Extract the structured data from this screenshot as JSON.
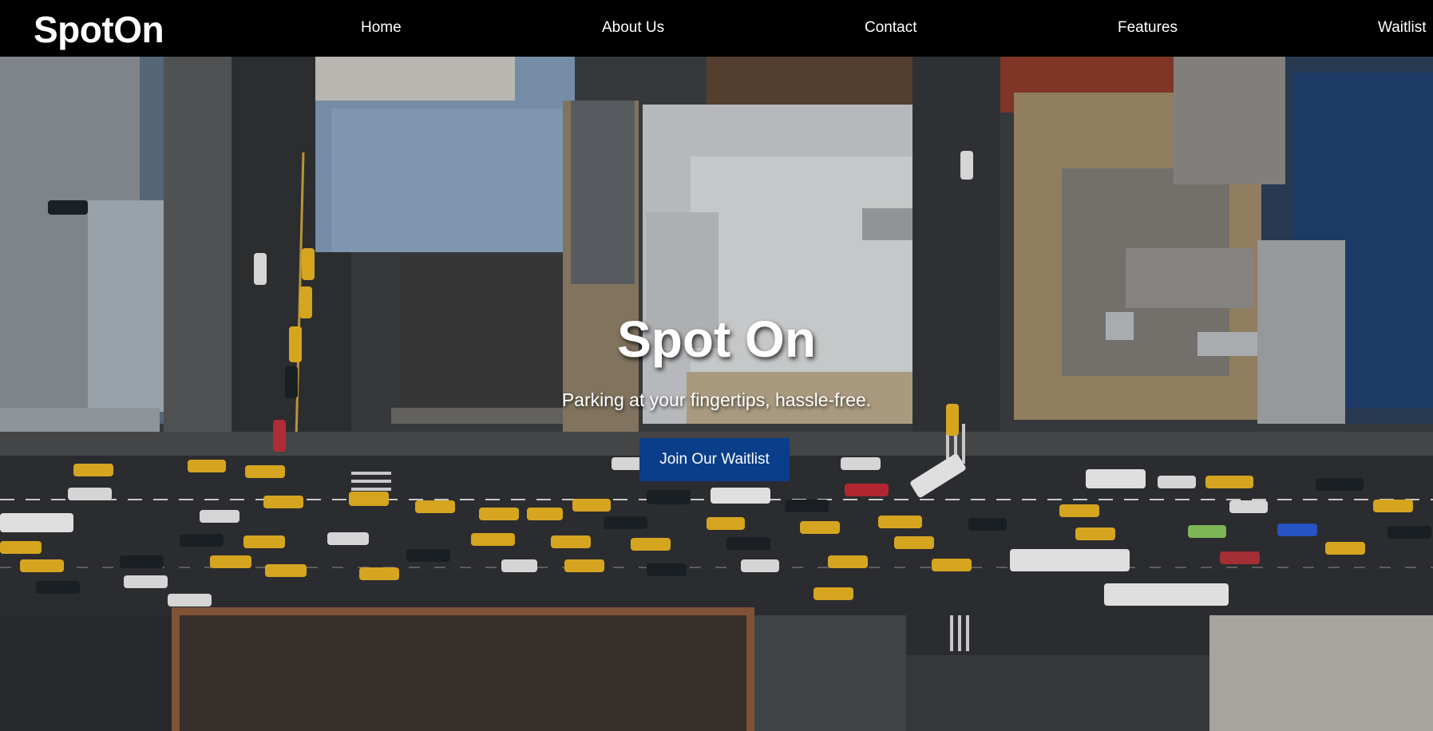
{
  "brand": {
    "logo": "SpotOn"
  },
  "nav": {
    "home": "Home",
    "about": "About Us",
    "contact": "Contact",
    "features": "Features",
    "waitlist": "Waitlist"
  },
  "hero": {
    "title": "Spot On",
    "subtitle": "Parking at your fingertips, hassle-free.",
    "cta_label": "Join Our Waitlist",
    "background_description_icon": "aerial-city-street-photo"
  },
  "colors": {
    "navbar_bg": "#000000",
    "cta_bg": "#0a3d8a",
    "text": "#ffffff"
  }
}
